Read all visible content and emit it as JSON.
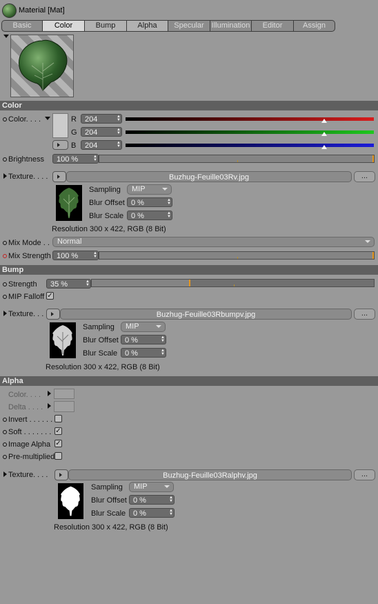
{
  "window": {
    "title": "Material [Mat]"
  },
  "tabs": [
    {
      "label": "Basic",
      "state": "dim"
    },
    {
      "label": "Color",
      "state": "active"
    },
    {
      "label": "Bump",
      "state": "normal"
    },
    {
      "label": "Alpha",
      "state": "normal"
    },
    {
      "label": "Specular",
      "state": "dim"
    },
    {
      "label": "Illumination",
      "state": "dim"
    },
    {
      "label": "Editor",
      "state": "dim"
    },
    {
      "label": "Assign",
      "state": "dim"
    }
  ],
  "color": {
    "header": "Color",
    "color_label": "Color. . . .",
    "r_label": "R",
    "g_label": "G",
    "b_label": "B",
    "r_value": "204",
    "g_value": "204",
    "b_value": "204",
    "rgb_fraction": 0.8,
    "swatch_color": "#cccccc",
    "brightness_label": "Brightness",
    "brightness_value": "100 %",
    "brightness_fraction": 1.0,
    "texture_label": "Texture. . . .",
    "texture_file": "Buzhug-Feuille03Rv.jpg",
    "browse_label": "...",
    "sampling_label": "Sampling",
    "sampling_value": "MIP",
    "blur_offset_label": "Blur Offset",
    "blur_offset_value": "0 %",
    "blur_scale_label": "Blur Scale",
    "blur_scale_value": "0 %",
    "resolution": "Resolution 300 x 422, RGB (8 Bit)",
    "mix_mode_label": "Mix Mode . .",
    "mix_mode_value": "Normal",
    "mix_strength_label": "Mix Strength",
    "mix_strength_value": "100 %",
    "mix_strength_fraction": 1.0
  },
  "bump": {
    "header": "Bump",
    "strength_label": "Strength",
    "strength_value": "35 %",
    "strength_fraction": 0.35,
    "mip_falloff_label": "MIP Falloff",
    "mip_falloff_checked": true,
    "texture_label": "Texture. . . .",
    "texture_file": "Buzhug-Feuille03Rbumpv.jpg",
    "browse_label": "...",
    "sampling_label": "Sampling",
    "sampling_value": "MIP",
    "blur_offset_label": "Blur Offset",
    "blur_offset_value": "0 %",
    "blur_scale_label": "Blur Scale",
    "blur_scale_value": "0 %",
    "resolution": "Resolution 300 x 422, RGB (8 Bit)"
  },
  "alpha": {
    "header": "Alpha",
    "color_label": "Color. . . .",
    "delta_label": "Delta . . . .",
    "invert_label": "Invert . . . . . .",
    "invert_checked": false,
    "soft_label": "Soft . . . . . . .",
    "soft_checked": true,
    "image_alpha_label": "Image Alpha",
    "image_alpha_checked": true,
    "premultiplied_label": "Pre-multiplied",
    "premultiplied_checked": false,
    "texture_label": "Texture. . . .",
    "texture_file": "Buzhug-Feuille03Ralphv.jpg",
    "browse_label": "...",
    "sampling_label": "Sampling",
    "sampling_value": "MIP",
    "blur_offset_label": "Blur Offset",
    "blur_offset_value": "0 %",
    "blur_scale_label": "Blur Scale",
    "blur_scale_value": "0 %",
    "resolution": "Resolution 300 x 422, RGB (8 Bit)"
  },
  "icons": {
    "material": "material-sphere-icon",
    "preview_toggle": "triangle-down-icon",
    "expand": "triangle-right-icon",
    "check": "checkmark-icon"
  },
  "colors": {
    "section_bg": "#5f5f5f",
    "panel_bg": "#999999",
    "accent": "#e6961e",
    "red": "#d81c1c",
    "green": "#1ec81e",
    "blue": "#1c1cd8"
  }
}
